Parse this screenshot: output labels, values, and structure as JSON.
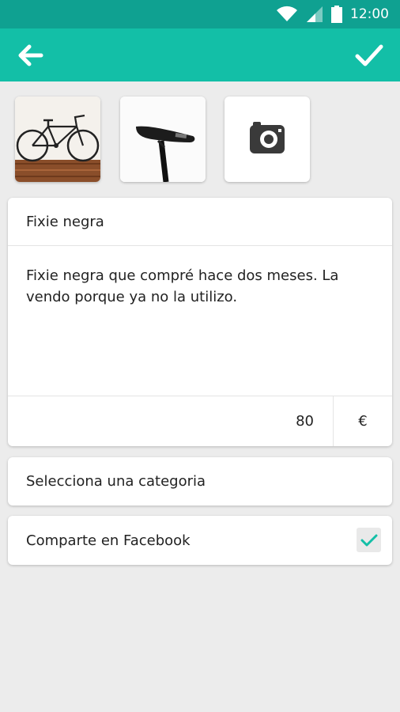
{
  "status_bar": {
    "time": "12:00",
    "icons": [
      "wifi-icon",
      "signal-icon",
      "battery-icon"
    ]
  },
  "app_bar": {
    "back_icon": "arrow-left-icon",
    "confirm_icon": "checkmark-icon",
    "color": "#13bfa7"
  },
  "photos": [
    {
      "name": "bicycle-photo"
    },
    {
      "name": "saddle-photo"
    },
    {
      "name": "add-photo-camera",
      "icon": "camera-icon"
    }
  ],
  "form": {
    "title": "Fixie negra",
    "description": "Fixie negra que compré hace dos meses. La vendo porque ya no la utilizo.",
    "price": "80",
    "currency": "€",
    "category_placeholder": "Selecciona una categoria",
    "share_label": "Comparte en Facebook",
    "share_checked": true
  }
}
